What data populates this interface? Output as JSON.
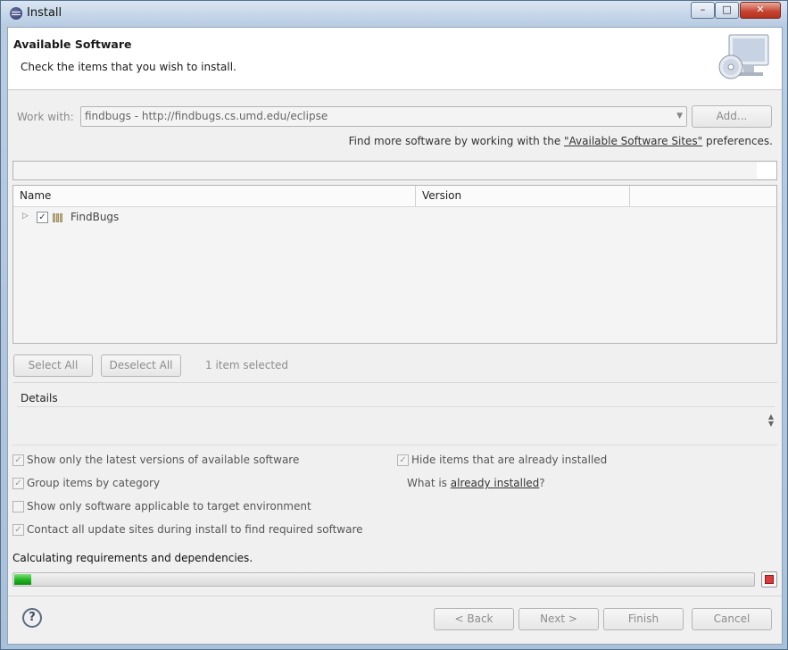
{
  "window": {
    "title": "Install"
  },
  "header": {
    "title": "Available Software",
    "description": "Check the items that you wish to install."
  },
  "work_with": {
    "label": "Work with:",
    "value": "findbugs - http://findbugs.cs.umd.edu/eclipse",
    "add_label": "Add...",
    "find_more_prefix": "Find more software by working with the ",
    "find_more_link": "\"Available Software Sites\"",
    "find_more_suffix": " preferences."
  },
  "tree": {
    "columns": [
      "Name",
      "Version"
    ],
    "rows": [
      {
        "name": "FindBugs",
        "version": "",
        "checked": true
      }
    ]
  },
  "selection": {
    "select_all_label": "Select All",
    "deselect_all_label": "Deselect All",
    "count_text": "1 item selected"
  },
  "details": {
    "label": "Details"
  },
  "options": {
    "latest_versions": {
      "label": "Show only the latest versions of available software",
      "checked": true
    },
    "group_by_category": {
      "label": "Group items by category",
      "checked": true
    },
    "target_environment": {
      "label": "Show only software applicable to target environment",
      "checked": false
    },
    "contact_all_sites": {
      "label": "Contact all update sites during install to find required software",
      "checked": true
    },
    "hide_installed": {
      "label": "Hide items that are already installed",
      "checked": true
    },
    "what_is_prefix": "What is ",
    "what_is_link": "already installed",
    "what_is_suffix": "?"
  },
  "status": {
    "text": "Calculating requirements and dependencies.",
    "progress_fraction": 0.023
  },
  "buttons": {
    "back": "< Back",
    "next": "Next >",
    "finish": "Finish",
    "cancel": "Cancel",
    "help": "?"
  },
  "colors": {
    "progress_fill": "#1eb31e",
    "stop": "#d93a3a"
  }
}
